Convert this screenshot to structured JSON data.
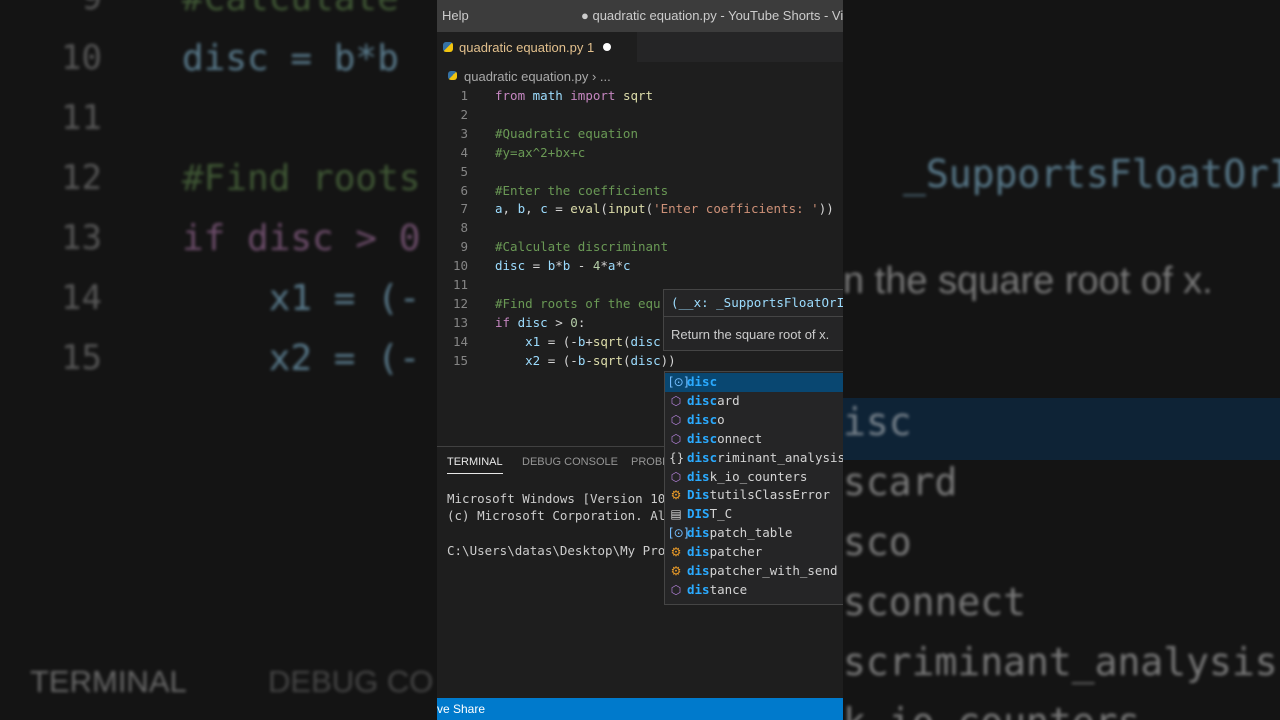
{
  "window": {
    "menu": "Help",
    "title": "● quadratic equation.py - YouTube Shorts - Visual"
  },
  "tab": {
    "name": "quadratic equation.py",
    "problem_count": "1"
  },
  "breadcrumb": {
    "file": "quadratic equation.py",
    "tail": "› ..."
  },
  "code_lines": [
    {
      "n": "1",
      "tokens": [
        [
          "kw",
          "from"
        ],
        [
          "tx",
          " "
        ],
        [
          "id",
          "math"
        ],
        [
          "tx",
          " "
        ],
        [
          "kw",
          "import"
        ],
        [
          "tx",
          " "
        ],
        [
          "fn",
          "sqrt"
        ]
      ]
    },
    {
      "n": "2",
      "tokens": []
    },
    {
      "n": "3",
      "tokens": [
        [
          "cm",
          "#Quadratic equation"
        ]
      ]
    },
    {
      "n": "4",
      "tokens": [
        [
          "cm",
          "#y=ax^2+bx+c"
        ]
      ]
    },
    {
      "n": "5",
      "tokens": []
    },
    {
      "n": "6",
      "tokens": [
        [
          "cm",
          "#Enter the coefficients"
        ]
      ]
    },
    {
      "n": "7",
      "tokens": [
        [
          "id",
          "a"
        ],
        [
          "tx",
          ", "
        ],
        [
          "id",
          "b"
        ],
        [
          "tx",
          ", "
        ],
        [
          "id",
          "c"
        ],
        [
          "tx",
          " = "
        ],
        [
          "fn",
          "eval"
        ],
        [
          "tx",
          "("
        ],
        [
          "fn",
          "input"
        ],
        [
          "tx",
          "("
        ],
        [
          "st",
          "'Enter coefficients: '"
        ],
        [
          "tx",
          "))"
        ]
      ]
    },
    {
      "n": "8",
      "tokens": []
    },
    {
      "n": "9",
      "tokens": [
        [
          "cm",
          "#Calculate discriminant"
        ]
      ]
    },
    {
      "n": "10",
      "tokens": [
        [
          "id",
          "disc"
        ],
        [
          "tx",
          " = "
        ],
        [
          "id",
          "b"
        ],
        [
          "tx",
          "*"
        ],
        [
          "id",
          "b"
        ],
        [
          "tx",
          " - "
        ],
        [
          "nm",
          "4"
        ],
        [
          "tx",
          "*"
        ],
        [
          "id",
          "a"
        ],
        [
          "tx",
          "*"
        ],
        [
          "id",
          "c"
        ]
      ]
    },
    {
      "n": "11",
      "tokens": []
    },
    {
      "n": "12",
      "tokens": [
        [
          "cm",
          "#Find roots of the equ"
        ]
      ]
    },
    {
      "n": "13",
      "tokens": [
        [
          "kw",
          "if"
        ],
        [
          "tx",
          " "
        ],
        [
          "id",
          "disc"
        ],
        [
          "tx",
          " > "
        ],
        [
          "nm",
          "0"
        ],
        [
          "tx",
          ":"
        ]
      ]
    },
    {
      "n": "14",
      "tokens": [
        [
          "tx",
          "    "
        ],
        [
          "id",
          "x1"
        ],
        [
          "tx",
          " = (-"
        ],
        [
          "id",
          "b"
        ],
        [
          "tx",
          "+"
        ],
        [
          "fn",
          "sqrt"
        ],
        [
          "tx",
          "("
        ],
        [
          "id",
          "disc"
        ]
      ]
    },
    {
      "n": "15",
      "tokens": [
        [
          "tx",
          "    "
        ],
        [
          "id",
          "x2"
        ],
        [
          "tx",
          " = (-"
        ],
        [
          "id",
          "b"
        ],
        [
          "tx",
          "-"
        ],
        [
          "fn",
          "sqrt"
        ],
        [
          "tx",
          "("
        ],
        [
          "id",
          "disc"
        ],
        [
          "tx",
          "))"
        ]
      ]
    }
  ],
  "hover": {
    "signature": "(__x: _SupportsFloatOrI",
    "doc": "Return the square root of x."
  },
  "suggestions": [
    {
      "icon": "variable-icon",
      "glyph": "[⊙]",
      "color": "#75beff",
      "match": "disc",
      "rest": "",
      "selected": true
    },
    {
      "icon": "module-icon",
      "glyph": "⬡",
      "color": "#b180d7",
      "match": "disc",
      "rest": "ard",
      "selected": false
    },
    {
      "icon": "module-icon",
      "glyph": "⬡",
      "color": "#b180d7",
      "match": "disc",
      "rest": "o",
      "selected": false
    },
    {
      "icon": "module-icon",
      "glyph": "⬡",
      "color": "#b180d7",
      "match": "disc",
      "rest": "onnect",
      "selected": false
    },
    {
      "icon": "namespace-icon",
      "glyph": "{}",
      "color": "#d4d4d4",
      "match": "disc",
      "rest": "riminant_analysis",
      "selected": false
    },
    {
      "icon": "module-icon",
      "glyph": "⬡",
      "color": "#b180d7",
      "match": "dis",
      "rest": "k_io_counters",
      "selected": false
    },
    {
      "icon": "class-icon",
      "glyph": "⚙",
      "color": "#ee9d28",
      "match": "Dis",
      "rest": "tutilsClassError",
      "selected": false
    },
    {
      "icon": "constant-icon",
      "glyph": "▤",
      "color": "#d4d4d4",
      "match": "DIS",
      "rest": "T_C",
      "selected": false
    },
    {
      "icon": "variable-icon",
      "glyph": "[⊙]",
      "color": "#75beff",
      "match": "dis",
      "rest": "patch_table",
      "selected": false
    },
    {
      "icon": "class-icon",
      "glyph": "⚙",
      "color": "#ee9d28",
      "match": "dis",
      "rest": "patcher",
      "selected": false
    },
    {
      "icon": "class-icon",
      "glyph": "⚙",
      "color": "#ee9d28",
      "match": "dis",
      "rest": "patcher_with_send",
      "selected": false
    },
    {
      "icon": "module-icon",
      "glyph": "⬡",
      "color": "#b180d7",
      "match": "dis",
      "rest": "tance",
      "selected": false
    }
  ],
  "panel": {
    "tabs": [
      "TERMINAL",
      "DEBUG CONSOLE",
      "PROBL"
    ],
    "terminal_lines": [
      "Microsoft Windows [Version 10",
      "(c) Microsoft Corporation. Al",
      "",
      "C:\\Users\\datas\\Desktop\\My Pro"
    ]
  },
  "statusbar": {
    "text": "ve Share"
  },
  "background": {
    "left_line_numbers": [
      "9",
      "10",
      "11",
      "12",
      "13",
      "14",
      "15"
    ],
    "left_code": [
      "#Calculate",
      "disc = b*b",
      "",
      "#Find roots",
      "if disc > 0",
      "    x1 = (-",
      "    x2 = (-"
    ],
    "right_signature": "_SupportsFloatOrI",
    "right_doc": "n the square root of x.",
    "right_suggestions": [
      "isc",
      "scard",
      "sco",
      "sconnect",
      "scriminant_analysis",
      "k_io_counters"
    ],
    "bottom_tabs": [
      "TERMINAL",
      "DEBUG CO"
    ]
  },
  "colors": {
    "editor_bg": "#1e1e1e",
    "statusbar": "#007acc",
    "selection": "#094771",
    "match_highlight": "#2aaaff"
  }
}
